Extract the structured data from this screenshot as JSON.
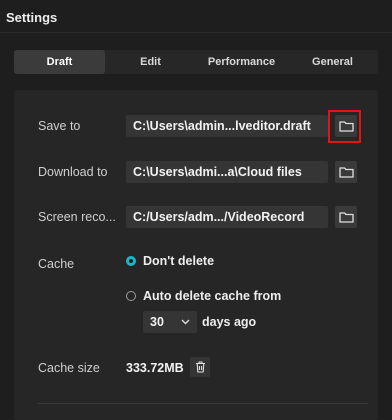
{
  "window": {
    "title": "Settings"
  },
  "tabs": [
    {
      "label": "Draft",
      "active": true
    },
    {
      "label": "Edit",
      "active": false
    },
    {
      "label": "Performance",
      "active": false
    },
    {
      "label": "General",
      "active": false
    }
  ],
  "draft": {
    "save_to": {
      "label": "Save to",
      "value": "C:\\Users\\admin...lveditor.draft",
      "icon": "folder-icon"
    },
    "download_to": {
      "label": "Download to",
      "value": "C:\\Users\\admi...a\\Cloud files",
      "icon": "folder-icon"
    },
    "screen_record": {
      "label": "Screen reco...",
      "value": "C:/Users/adm.../VideoRecord",
      "icon": "folder-icon"
    },
    "cache": {
      "label": "Cache",
      "options": [
        {
          "label": "Don't delete",
          "selected": true
        },
        {
          "label": "Auto delete cache from",
          "selected": false
        }
      ],
      "days_value": "30",
      "days_suffix": "days ago"
    },
    "cache_size": {
      "label": "Cache size",
      "value": "333.72MB",
      "icon": "trash-icon"
    }
  },
  "colors": {
    "accent": "#19b8c8",
    "highlight": "#e21515",
    "background": "#1e1e1e",
    "panel": "#262626"
  }
}
